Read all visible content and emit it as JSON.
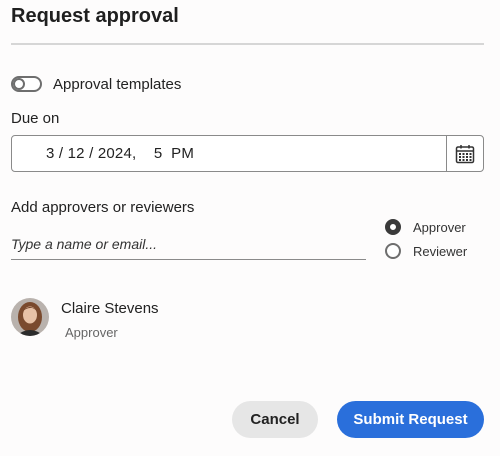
{
  "dialog": {
    "title": "Request approval"
  },
  "templates_toggle": {
    "label": "Approval templates",
    "on": false
  },
  "due": {
    "label": "Due on",
    "value": "3 / 12 / 2024,    5  PM",
    "calendar_icon": "calendar-icon"
  },
  "approvers": {
    "label": "Add approvers or reviewers",
    "placeholder": "Type a name or email...",
    "roles": [
      {
        "label": "Approver",
        "checked": true
      },
      {
        "label": "Reviewer",
        "checked": false
      }
    ]
  },
  "selected_users": [
    {
      "name": "Claire Stevens",
      "role": "Approver"
    }
  ],
  "actions": {
    "cancel_label": "Cancel",
    "submit_label": "Submit Request"
  },
  "colors": {
    "primary": "#2a6fdb",
    "secondary_button": "#e6e6e6",
    "background": "#fdfcfc"
  }
}
